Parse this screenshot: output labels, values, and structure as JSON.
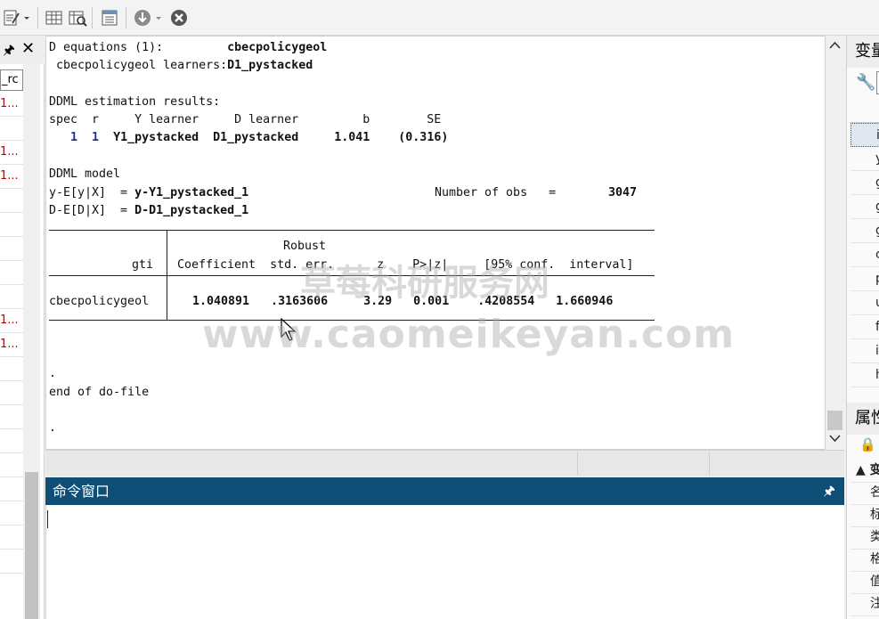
{
  "results_text": {
    "l1_label": "D equations (1):",
    "l1_value": "cbecpolicygeol",
    "l2_label": " cbecpolicygeol learners:",
    "l2_value": "D1_pystacked",
    "l4": "DDML estimation results:",
    "l5": "spec  r     Y learner     D learner         b        SE",
    "l6_spec": "   1",
    "l6_r": "1",
    "l6_rest": "Y1_pystacked  D1_pystacked     1.041    (0.316)",
    "l8": "DDML model",
    "l9_label": "y-E[y|X]  = ",
    "l9_value": "y-Y1_pystacked_1",
    "l9_obs_label": "Number of obs   =",
    "l9_obs_value": "3047",
    "l10_label": "D-E[D|X]  = ",
    "l10_value": "D-D1_pystacked_1",
    "table_hdr1": "Robust",
    "table_col_var": "gti",
    "table_cols": "Coefficient  std. err.      z    P>|z|     [95% conf.  interval]",
    "table_row_var": "cbecpolicygeol",
    "table_row_vals": "1.040891   .3163606     3.29   0.001    .4208554   1.660946",
    "dot1": ".",
    "end": "end of do-file",
    "dot2": "."
  },
  "command_window": {
    "title": "命令窗口",
    "pin": "🖈"
  },
  "left_panel": {
    "header_label": "_rc",
    "rows": [
      "1...",
      "",
      "1...",
      "1...",
      "",
      "",
      "",
      "",
      "",
      "1...",
      "1...",
      "",
      "",
      "",
      "",
      "",
      "",
      "",
      "",
      ""
    ]
  },
  "right_panel": {
    "var_title": "变量",
    "var_rows": [
      "i",
      "y",
      "g",
      "g",
      "g",
      "c",
      "p",
      "u",
      "fi",
      "ir",
      "h"
    ],
    "prop_title": "属性",
    "prop_rows": [
      "▲ 变",
      "名",
      "标",
      "类",
      "格",
      "值",
      "注"
    ]
  },
  "watermark": {
    "cn": "草莓科研服务网",
    "url": "www.caomeikeyan.com"
  },
  "colors": {
    "cmd_header": "#0e4f78",
    "learner_index": "#1f2fa6"
  }
}
